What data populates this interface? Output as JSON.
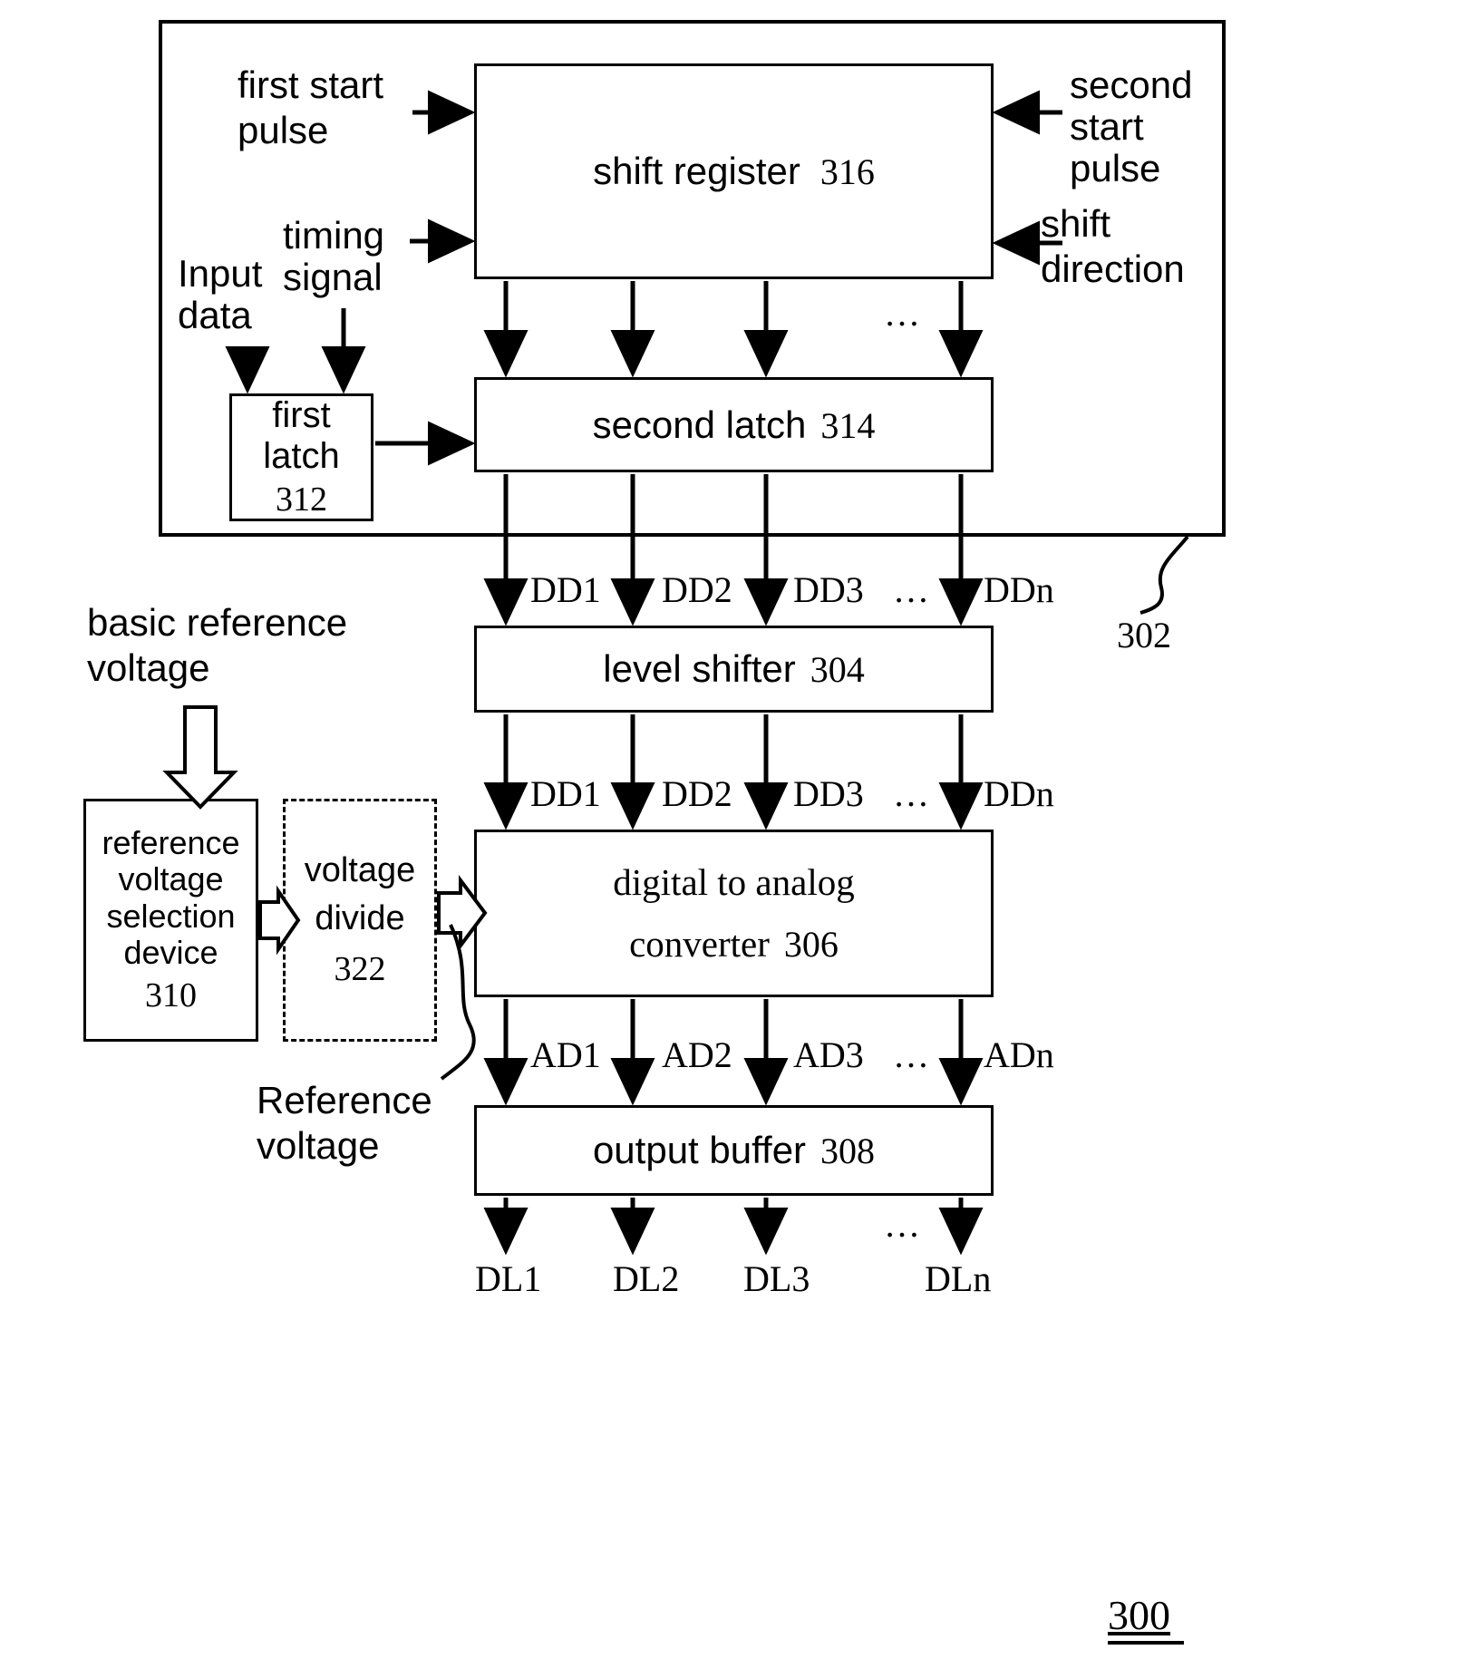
{
  "figure": {
    "number": "300",
    "outer_block_ref": "302"
  },
  "blocks": {
    "shift_register": {
      "title": "shift register",
      "ref": "316"
    },
    "first_latch": {
      "line1": "first",
      "line2": "latch",
      "ref": "312"
    },
    "second_latch": {
      "title": "second latch",
      "ref": "314"
    },
    "level_shifter": {
      "title": "level shifter",
      "ref": "304"
    },
    "dac": {
      "line1": "digital to analog",
      "line2": "converter",
      "ref": "306"
    },
    "output_buffer": {
      "title": "output buffer",
      "ref": "308"
    },
    "ref_voltage_selection": {
      "line1": "reference",
      "line2": "voltage",
      "line3": "selection",
      "line4": "device",
      "ref": "310"
    },
    "voltage_divide": {
      "line1": "voltage",
      "line2": "divide",
      "ref": "322"
    }
  },
  "signals": {
    "first_start_pulse": "first start\npulse",
    "first_start_pulse_l1": "first start",
    "first_start_pulse_l2": "pulse",
    "second_start_pulse_l1": "second",
    "second_start_pulse_l2": "start",
    "second_start_pulse_l3": "pulse",
    "shift_direction_l1": "shift",
    "shift_direction_l2": "direction",
    "timing_signal_l1": "timing",
    "timing_signal_l2": "signal",
    "input_data_l1": "Input",
    "input_data_l2": "data",
    "basic_reference_voltage_l1": "basic reference",
    "basic_reference_voltage_l2": "voltage",
    "reference_voltage_l1": "Reference",
    "reference_voltage_l2": "voltage"
  },
  "bus_labels": {
    "dd_row_1": [
      "DD1",
      "DD2",
      "DD3",
      "…",
      "DDn"
    ],
    "dd_row_2": [
      "DD1",
      "DD2",
      "DD3",
      "…",
      "DDn"
    ],
    "ad_row": [
      "AD1",
      "AD2",
      "AD3",
      "…",
      "ADn"
    ],
    "dl_row": [
      "DL1",
      "DL2",
      "DL3",
      "DLn"
    ],
    "ellipsis": "…"
  },
  "colors": {
    "stroke": "#000000",
    "background": "#ffffff"
  }
}
